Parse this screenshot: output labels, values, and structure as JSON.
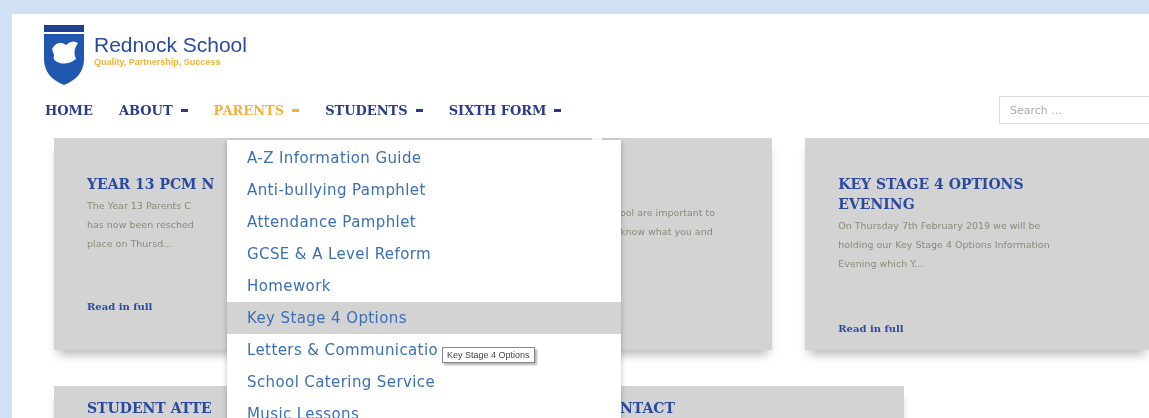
{
  "logo": {
    "name": "Rednock School",
    "tagline": "Quality, Partnership, Success"
  },
  "nav": [
    {
      "label": "HOME",
      "dropdown": false,
      "selected": false
    },
    {
      "label": "ABOUT",
      "dropdown": true,
      "selected": false
    },
    {
      "label": "PARENTS",
      "dropdown": true,
      "selected": true
    },
    {
      "label": "STUDENTS",
      "dropdown": true,
      "selected": false
    },
    {
      "label": "SIXTH FORM",
      "dropdown": true,
      "selected": false
    }
  ],
  "search": {
    "placeholder": "Search ..."
  },
  "cards": [
    {
      "title": [
        "YEAR 13 PCM N"
      ],
      "lines": [
        "The Year 13 Parents C",
        "has now been resched",
        "place on Thursd..."
      ],
      "link": "Read in full"
    },
    {
      "lines": [
        "ool are important to",
        "know what you and"
      ]
    },
    {
      "title": [
        "KEY STAGE 4 OPTIONS",
        "EVENING"
      ],
      "lines": [
        "On Thursday 7th February 2019 we will be",
        "holding our Key Stage 4 Options Information",
        "Evening which Y..."
      ],
      "link": "Read in full"
    }
  ],
  "cards_row_2": [
    {
      "title": "STUDENT ATTE"
    },
    {
      "title": "NTACT"
    }
  ],
  "dropdown": [
    {
      "label": "A-Z Information Guide",
      "highlighted": false
    },
    {
      "label": "Anti-bullying Pamphlet",
      "highlighted": false
    },
    {
      "label": "Attendance Pamphlet",
      "highlighted": false
    },
    {
      "label": "GCSE & A Level Reform",
      "highlighted": false
    },
    {
      "label": "Homework",
      "highlighted": false
    },
    {
      "label": "Key Stage 4 Options",
      "highlighted": true
    },
    {
      "label": "Letters & Communicatio",
      "highlighted": false
    },
    {
      "label": "School Catering Service",
      "highlighted": false
    },
    {
      "label": "Music Lessons",
      "highlighted": false
    }
  ],
  "tooltip": "Key Stage 4 Options"
}
